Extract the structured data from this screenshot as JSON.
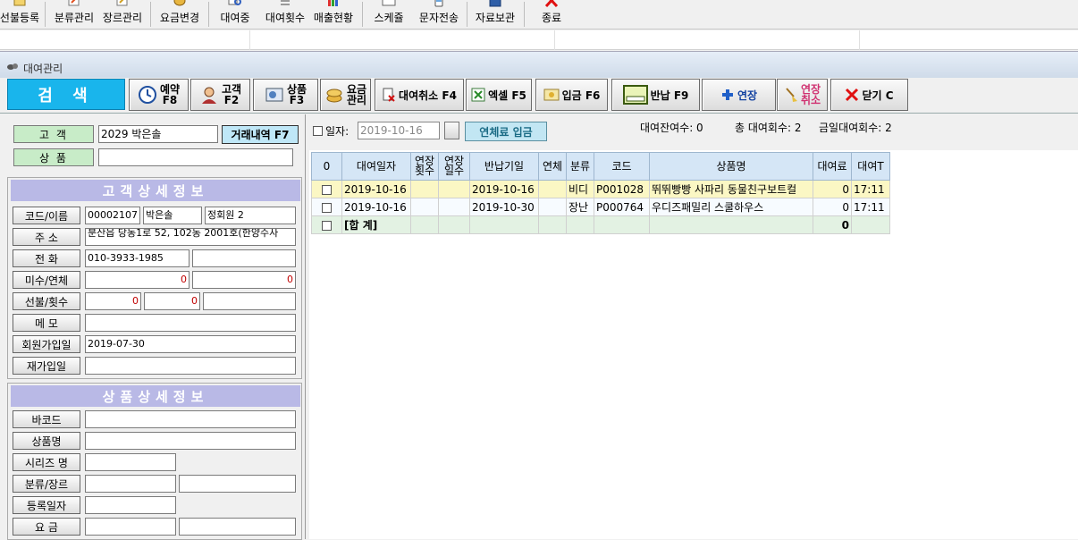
{
  "toolbar": {
    "items": [
      {
        "label": "선불등록",
        "icon": "prepaid-icon"
      },
      {
        "label": "분류관리",
        "icon": "category-icon"
      },
      {
        "label": "장르관리",
        "icon": "genre-icon"
      },
      {
        "label": "요금변경",
        "icon": "fee-icon"
      },
      {
        "label": "대여중",
        "icon": "renting-icon"
      },
      {
        "label": "대여횟수",
        "icon": "rental-count-icon"
      },
      {
        "label": "매출현황",
        "icon": "sales-chart-icon"
      },
      {
        "label": "스케쥴",
        "icon": "schedule-icon"
      },
      {
        "label": "문자전송",
        "icon": "sms-icon"
      },
      {
        "label": "자료보관",
        "icon": "save-disk-icon"
      },
      {
        "label": "종료",
        "icon": "exit-icon"
      }
    ]
  },
  "window": {
    "title": "대여관리"
  },
  "actions": {
    "search": "검 색",
    "reserve": [
      "예약",
      "F8"
    ],
    "customer": [
      "고객",
      "F2"
    ],
    "product": [
      "상품",
      "F3"
    ],
    "fee": [
      "요금",
      "관리"
    ],
    "cancel_rental": "대여취소 F4",
    "excel": "엑셀 F5",
    "deposit": "입금 F6",
    "return": "반납 F9",
    "extend": "연장",
    "cancel_extend": [
      "연장",
      "취소"
    ],
    "close": "닫기 C"
  },
  "left": {
    "customer_label": "고    객",
    "customer_value": "2029 박은솔",
    "history_button": "거래내역 F7",
    "product_label": "상    품",
    "product_value": "",
    "customer_section": "고객상세정보",
    "code_label": "코드/이름",
    "code": "00002107",
    "name": "박은솔",
    "grade": "정회원 2",
    "address_label": "주 소",
    "address": "분산읍 당동1로 52, 102동 2001호(한양수사",
    "phone_label": "전 화",
    "phone": "010-3933-1985",
    "phone2": "",
    "unpaid_label": "미수/연체",
    "unpaid": "0",
    "overdue": "0",
    "prepaid_label": "선불/횟수",
    "prepaid": "0",
    "prepaid_count": "0",
    "prepaid_extra": "",
    "memo_label": "메 모",
    "memo": "",
    "join_label": "회원가입일",
    "join_date": "2019-07-30",
    "rejoin_label": "재가입일",
    "rejoin_date": "",
    "product_section": "상품상세정보",
    "barcode_label": "바코드",
    "pname_label": "상품명",
    "series_label": "시리즈 명",
    "cat_label": "분류/장르",
    "reg_label": "등록일자",
    "price_label": "요 금"
  },
  "right": {
    "date_label": "일자:",
    "date_value": "2019-10-16",
    "overdue_pay": "연체료 입금",
    "stats": {
      "remaining": "대여잔여수: 0",
      "total": "총 대여회수: 2",
      "today": "금일대여회수: 2"
    },
    "columns": [
      "0",
      "대여일자",
      "연장\n횟수",
      "연장\n일수",
      "반납기일",
      "연체",
      "분류",
      "코드",
      "상품명",
      "대여료",
      "대여T"
    ],
    "rows": [
      {
        "rent_date": "2019-10-16",
        "ext_count": "",
        "ext_days": "",
        "due": "2019-10-16",
        "overdue": "",
        "cat": "비디",
        "code": "P001028",
        "name": "뛰뛰빵빵 사파리 동물친구보트컬",
        "fee": "0",
        "time": "17:11"
      },
      {
        "rent_date": "2019-10-16",
        "ext_count": "",
        "ext_days": "",
        "due": "2019-10-30",
        "overdue": "",
        "cat": "장난",
        "code": "P000764",
        "name": "우디즈패밀리 스쿨하우스",
        "fee": "0",
        "time": "17:11"
      }
    ],
    "summary": {
      "label": "[합 계]",
      "fee": "0"
    }
  },
  "colors": {
    "accent": "#19b5ec",
    "section": "#b9b9e6",
    "label_green": "#c8ecc8",
    "selected_row": "#fbf7c4"
  }
}
